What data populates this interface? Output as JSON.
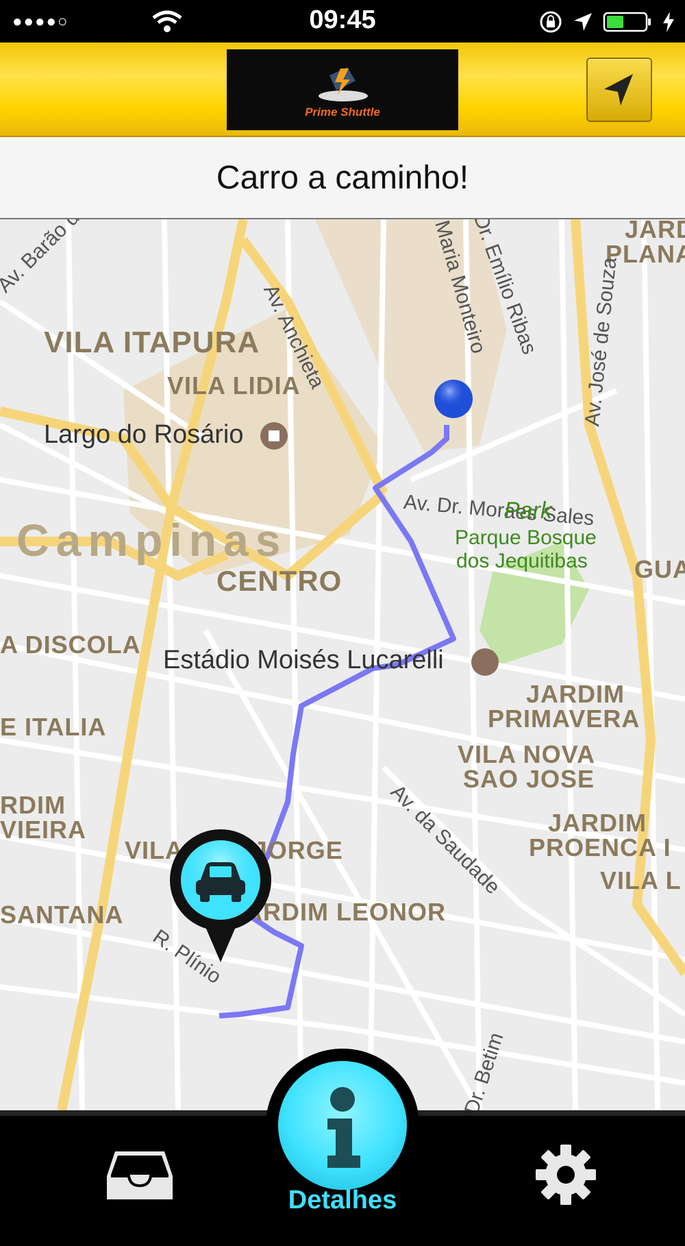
{
  "status_bar": {
    "signal": "●●●●○",
    "time": "09:45"
  },
  "header": {
    "logo_text": "Prime Shuttle"
  },
  "notice": {
    "message": "Carro a caminho!"
  },
  "map": {
    "labels": [
      "VILA ITAPURA",
      "VILA LIDIA",
      "Largo do Rosário",
      "Campinas",
      "CENTRO",
      "A DISCOLA",
      "Estádio Moisés Lucarelli",
      "E ITALIA",
      "RDIM",
      "VIEIRA",
      "VILA SÃO JORGE",
      "SANTANA",
      "JARDIM LEONOR",
      "JARDIM",
      "PRIMAVERA",
      "VILA NOVA",
      "SAO JOSE",
      "JARDIM",
      "PROENCA I",
      "VILA L",
      "GUA",
      "JARD",
      "PLANA"
    ],
    "streets": [
      "Av. Barão de Itapura",
      "Av. Anchieta",
      "Maria Monteiro",
      "Dr. Emílio Ribas",
      "Av. José de Souza",
      "Av. Dr. Moraes Sales",
      "Av. da Saudade",
      "R. Plínio",
      "Dr. Betim"
    ],
    "park_title": "Park",
    "park_name_line1": "Parque Bosque",
    "park_name_line2": "dos Jequitibas",
    "route_color": "#7b78f5",
    "user_location_color": "#1f4ed8",
    "car_marker_color": "#3fe2ff"
  },
  "tabs": {
    "inbox_icon": "inbox-tray-icon",
    "details_label": "Detalhes",
    "details_icon": "info-icon",
    "settings_icon": "gear-icon"
  }
}
